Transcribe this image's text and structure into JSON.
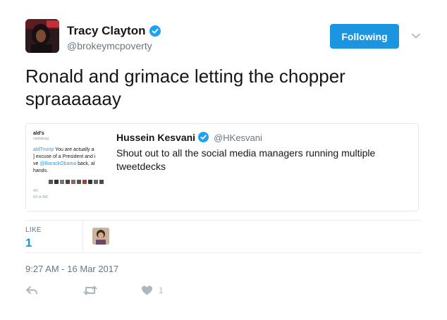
{
  "header": {
    "display_name": "Tracy Clayton",
    "handle": "@brokeymcpoverty",
    "follow_label": "Following"
  },
  "tweet": {
    "text": "Ronald and grimace letting the chopper spraaaaaay"
  },
  "quote": {
    "display_name": "Hussein Kesvani",
    "handle": "@HKesvani",
    "text": "Shout out to all the social media managers running multiple tweetdecks",
    "thumb": {
      "line1": "ald's",
      "line2": "naldsburg",
      "line3a": "aldTrump",
      "line3b": " You are actually a",
      "line4": "] excuse of a President and i",
      "line5a": "ve ",
      "line5b": "@BarackObama",
      "line5c": " back, al",
      "line6": "hands.",
      "stat1": "4/1",
      "stat2": "6/1  ♥ 266"
    }
  },
  "stats": {
    "like_label": "LIKE",
    "like_count": "1"
  },
  "timestamp": "9:27 AM - 16 Mar 2017",
  "actions": {
    "like_count": "1"
  },
  "colors": {
    "accent": "#1b95e0",
    "muted": "#657786",
    "icon": "#aab8c2",
    "border": "#e1e8ed"
  },
  "icons": [
    "verified-badge-icon",
    "chevron-down-icon",
    "reply-icon",
    "retweet-icon",
    "heart-icon"
  ]
}
